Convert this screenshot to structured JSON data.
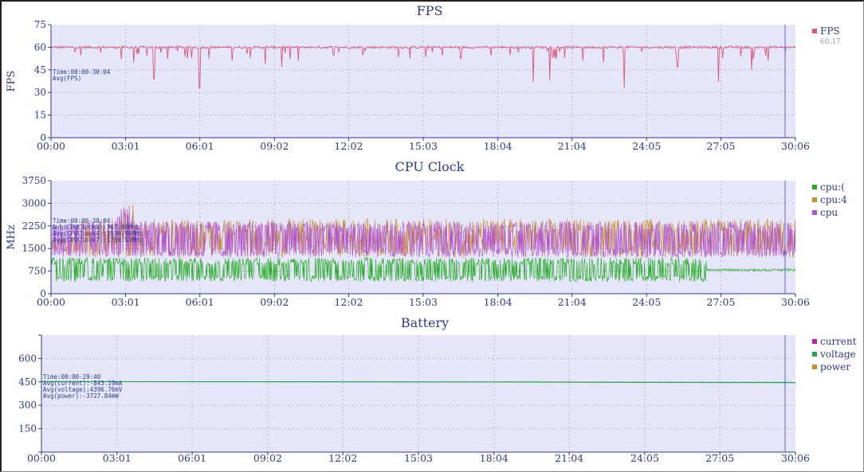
{
  "chart_data": [
    {
      "type": "line",
      "title": "FPS",
      "ylabel": "FPS",
      "xlabel": "",
      "ylim": [
        0,
        75
      ],
      "yticks": [
        0,
        15,
        30,
        45,
        60,
        75
      ],
      "xlim": [
        "00:00",
        "30:06"
      ],
      "xticks": [
        "00:00",
        "03:01",
        "06:01",
        "09:02",
        "12:02",
        "15:03",
        "18:04",
        "21:04",
        "24:05",
        "27:05",
        "30:06"
      ],
      "legend_position": "right",
      "grid": true,
      "annotation": [
        "Time:00:00-30:04",
        "Avg(FPS)"
      ],
      "series": [
        {
          "name": "FPS",
          "legend_value": "60.17",
          "color": "#d9577a",
          "baseline": 60,
          "dips": [
            {
              "t": "02:50",
              "v": 52
            },
            {
              "t": "03:20",
              "v": 50
            },
            {
              "t": "04:10",
              "v": 39
            },
            {
              "t": "06:00",
              "v": 33
            },
            {
              "t": "07:20",
              "v": 51
            },
            {
              "t": "08:40",
              "v": 49
            },
            {
              "t": "09:20",
              "v": 47
            },
            {
              "t": "10:00",
              "v": 51
            },
            {
              "t": "19:30",
              "v": 37
            },
            {
              "t": "20:10",
              "v": 38
            },
            {
              "t": "21:30",
              "v": 51
            },
            {
              "t": "22:20",
              "v": 50
            },
            {
              "t": "23:10",
              "v": 33
            },
            {
              "t": "25:20",
              "v": 47
            },
            {
              "t": "27:00",
              "v": 37
            },
            {
              "t": "28:20",
              "v": 45
            },
            {
              "t": "29:00",
              "v": 51
            }
          ]
        }
      ]
    },
    {
      "type": "line",
      "title": "CPU Clock",
      "ylabel": "MHz",
      "xlabel": "",
      "ylim": [
        0,
        3750
      ],
      "yticks": [
        0,
        750,
        1500,
        2250,
        3000,
        3750
      ],
      "xlim": [
        "00:00",
        "30:06"
      ],
      "xticks": [
        "00:00",
        "03:01",
        "06:01",
        "09:02",
        "12:02",
        "15:03",
        "18:04",
        "21:04",
        "24:05",
        "27:05",
        "30:06"
      ],
      "legend_position": "right",
      "grid": true,
      "annotation": [
        "Time:00:00-30:04",
        "Avg(CPUClock0):767.08MHz",
        "Avg(CPUClock4):1936.96MHz",
        "Avg(CPUClock7):1750.53MHz"
      ],
      "series": [
        {
          "name": "cpu:(",
          "color": "#22aa22",
          "avg": 767.08,
          "range": [
            400,
            1200
          ]
        },
        {
          "name": "cpu:4",
          "color": "#c8902a",
          "avg": 1936.96,
          "range": [
            1200,
            2500
          ]
        },
        {
          "name": "cpu",
          "color": "#b04fd8",
          "avg": 1750.53,
          "range": [
            1200,
            2400
          ]
        }
      ]
    },
    {
      "type": "line",
      "title": "Battery",
      "ylabel": "",
      "xlabel": "",
      "ylim": [
        0,
        750
      ],
      "yticks": [
        "0",
        "150",
        "300",
        "450",
        "600",
        "750"
      ],
      "ytick_labels_shown": [
        "150",
        "300",
        "450",
        "600"
      ],
      "xlim": [
        "00:00",
        "30:06"
      ],
      "xticks": [
        "00:00",
        "03:01",
        "06:01",
        "09:02",
        "12:02",
        "15:03",
        "18:04",
        "21:04",
        "24:05",
        "27:05",
        "30:06"
      ],
      "legend_position": "right",
      "grid": true,
      "annotation": [
        "Time:00:00-29:40",
        "Avg(current):-843.19mA",
        "Avg(voltage):4396.76mV",
        "Avg(power):-3727.84mW"
      ],
      "series": [
        {
          "name": "current",
          "color": "#c020a0"
        },
        {
          "name": "voltage",
          "color": "#22aa44",
          "values": [
            {
              "t": "00:00",
              "v": 452
            },
            {
              "t": "17:50",
              "v": 450
            },
            {
              "t": "24:05",
              "v": 447
            },
            {
              "t": "30:06",
              "v": 446
            }
          ]
        },
        {
          "name": "power",
          "color": "#c8902a"
        }
      ]
    }
  ]
}
